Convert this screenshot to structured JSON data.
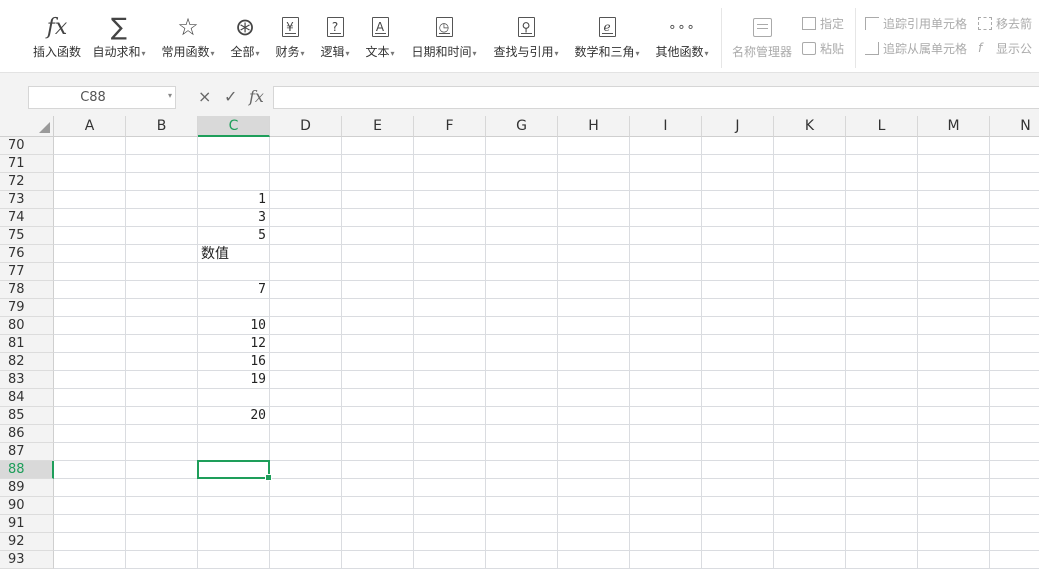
{
  "ribbon": {
    "buttons": [
      {
        "id": "insert-function",
        "label": "插入函数",
        "icon": "fx-icon",
        "glyph": "fx",
        "dropdown": false
      },
      {
        "id": "autosum",
        "label": "自动求和",
        "icon": "sigma-icon",
        "glyph": "∑",
        "dropdown": true
      },
      {
        "id": "common-functions",
        "label": "常用函数",
        "icon": "star-icon",
        "glyph": "☆",
        "dropdown": true
      },
      {
        "id": "all-functions",
        "label": "全部",
        "icon": "asterisk-icon",
        "glyph": "⊛",
        "dropdown": true
      },
      {
        "id": "finance",
        "label": "财务",
        "icon": "yen-icon",
        "glyph": "¥",
        "dropdown": true
      },
      {
        "id": "logic",
        "label": "逻辑",
        "icon": "question-icon",
        "glyph": "?",
        "dropdown": true
      },
      {
        "id": "text",
        "label": "文本",
        "icon": "text-a-icon",
        "glyph": "A",
        "dropdown": true
      },
      {
        "id": "datetime",
        "label": "日期和时间",
        "icon": "clock-icon",
        "glyph": "◷",
        "dropdown": true
      },
      {
        "id": "lookup",
        "label": "查找与引用",
        "icon": "magnifier-icon",
        "glyph": "⚲",
        "dropdown": true
      },
      {
        "id": "math",
        "label": "数学和三角",
        "icon": "e-icon",
        "glyph": "e",
        "dropdown": true
      },
      {
        "id": "other",
        "label": "其他函数",
        "icon": "more-icon",
        "glyph": "∘∘∘",
        "dropdown": true
      }
    ],
    "name_manager": {
      "label": "名称管理器",
      "icon": "name-manager-icon"
    },
    "define": {
      "label": "指定",
      "icon": "define-icon"
    },
    "paste": {
      "label": "粘贴",
      "icon": "paste-icon"
    },
    "trace_precedents": {
      "label": "追踪引用单元格",
      "icon": "trace-precedents-icon"
    },
    "trace_dependents": {
      "label": "追踪从属单元格",
      "icon": "trace-dependents-icon"
    },
    "remove_arrows": {
      "label": "移去箭",
      "icon": "remove-arrows-icon"
    },
    "show_formulas": {
      "label": "显示公",
      "icon": "show-formulas-icon"
    }
  },
  "formula_bar": {
    "name_box": "C88",
    "cancel_glyph": "×",
    "confirm_glyph": "✓",
    "fx_glyph": "fx",
    "value": ""
  },
  "sheet": {
    "columns": [
      "A",
      "B",
      "C",
      "D",
      "E",
      "F",
      "G",
      "H",
      "I",
      "J",
      "K",
      "L",
      "M",
      "N"
    ],
    "selected_column": "C",
    "rows": [
      70,
      71,
      72,
      73,
      74,
      75,
      76,
      77,
      78,
      79,
      80,
      81,
      82,
      83,
      84,
      85,
      86,
      87,
      88,
      89,
      90,
      91,
      92,
      93
    ],
    "selected_row": 88,
    "active_cell": "C88",
    "cells": [
      {
        "ref": "C73",
        "col": "C",
        "row": 73,
        "value": "1",
        "kind": "num"
      },
      {
        "ref": "C74",
        "col": "C",
        "row": 74,
        "value": "3",
        "kind": "num"
      },
      {
        "ref": "C75",
        "col": "C",
        "row": 75,
        "value": "5",
        "kind": "num"
      },
      {
        "ref": "C76",
        "col": "C",
        "row": 76,
        "value": "数值",
        "kind": "txt"
      },
      {
        "ref": "C78",
        "col": "C",
        "row": 78,
        "value": "7",
        "kind": "num"
      },
      {
        "ref": "C80",
        "col": "C",
        "row": 80,
        "value": "10",
        "kind": "num"
      },
      {
        "ref": "C81",
        "col": "C",
        "row": 81,
        "value": "12",
        "kind": "num"
      },
      {
        "ref": "C82",
        "col": "C",
        "row": 82,
        "value": "16",
        "kind": "num"
      },
      {
        "ref": "C83",
        "col": "C",
        "row": 83,
        "value": "19",
        "kind": "num"
      },
      {
        "ref": "C85",
        "col": "C",
        "row": 85,
        "value": "20",
        "kind": "num"
      }
    ]
  },
  "colors": {
    "accent": "#1e9e5a",
    "header_bg": "#f3f3f3",
    "grid_line": "#dadce0"
  }
}
